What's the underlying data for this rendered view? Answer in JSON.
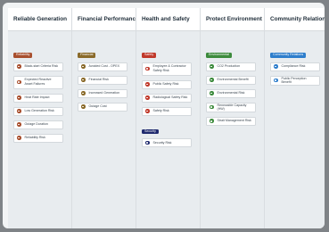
{
  "colors": {
    "reliability": "#a84f2e",
    "financial": "#8a6a2a",
    "safety": "#c0392b",
    "security": "#1f2a6e",
    "environmental": "#3d8b3d",
    "community": "#2e7ecc"
  },
  "columns": [
    {
      "title": "Reliable Generation",
      "groups": [
        {
          "tag": "Reliability",
          "color": "#a84f2e",
          "items": [
            "Black-start Criteria Risk",
            "Expected Reactive Asset Failures",
            "Heat Rate Impact",
            "Low Generation Risk",
            "Outage Duration",
            "Reliability Risk"
          ]
        }
      ]
    },
    {
      "title": "Financial Performance",
      "groups": [
        {
          "tag": "Financial",
          "color": "#8a6a2a",
          "items": [
            "Avoided Cost - OPEX",
            "Financial Risk",
            "Increased Generation",
            "Outage Cost"
          ]
        }
      ]
    },
    {
      "title": "Health and Safety",
      "groups": [
        {
          "tag": "Safety",
          "color": "#c0392b",
          "items": [
            "Employee & Contractor Safety Risk",
            "Public Safety Risk",
            "Radiological Safety Risk",
            "Safety Risk"
          ]
        },
        {
          "tag": "Security",
          "color": "#1f2a6e",
          "items": [
            "Security Risk"
          ]
        }
      ]
    },
    {
      "title": "Protect Environment",
      "groups": [
        {
          "tag": "Environmental",
          "color": "#3d8b3d",
          "items": [
            "CO2 Production",
            "Environmental Benefit",
            "Environmental Risk",
            "Renewable Capacity (HW)",
            "Strait Management Risk"
          ]
        }
      ]
    },
    {
      "title": "Community Relations",
      "groups": [
        {
          "tag": "Community Relations",
          "color": "#2e7ecc",
          "items": [
            "Compliance Risk",
            "Public Perception Benefit"
          ]
        }
      ]
    }
  ]
}
